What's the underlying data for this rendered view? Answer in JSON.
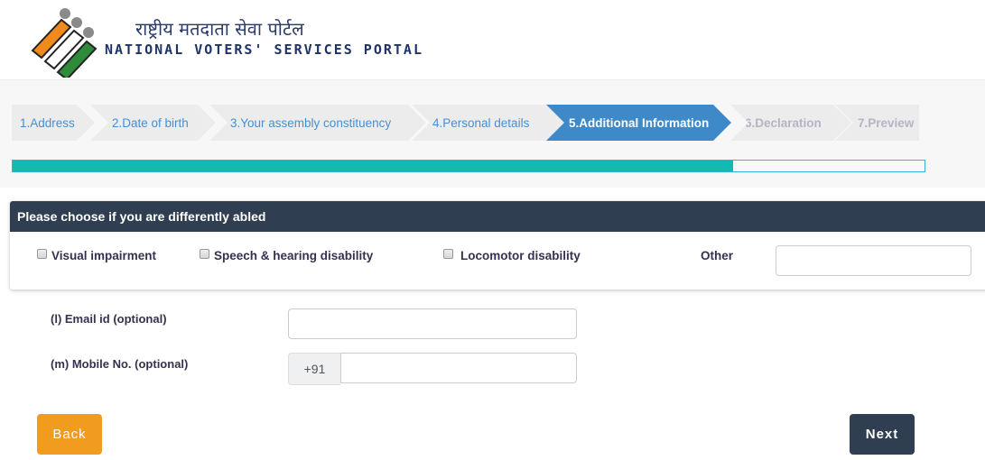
{
  "header": {
    "title_hindi": "राष्ट्रीय मतदाता सेवा पोर्टल",
    "title_english": "NATIONAL VOTERS' SERVICES PORTAL",
    "logo_colors": {
      "saffron": "#f08a1c",
      "green": "#2e8b3a",
      "gray": "#8a8a8a"
    }
  },
  "steps": [
    {
      "label": "1.Address",
      "state": "done"
    },
    {
      "label": "2.Date of birth",
      "state": "done"
    },
    {
      "label": "3.Your assembly constituency",
      "state": "done"
    },
    {
      "label": "4.Personal details",
      "state": "done"
    },
    {
      "label": "5.Additional Information",
      "state": "active"
    },
    {
      "label": "6.Declaration",
      "state": "disabled"
    },
    {
      "label": "7.Preview",
      "state": "disabled"
    }
  ],
  "progress": {
    "percent": 79,
    "color": "#13b9b1"
  },
  "disability_panel": {
    "title": "Please choose if you are differently abled",
    "options": [
      {
        "label": "Visual impairment",
        "checked": false
      },
      {
        "label": "Speech & hearing disability",
        "checked": false
      },
      {
        "label": "Locomotor disability",
        "checked": false
      }
    ],
    "other_label": "Other",
    "other_value": ""
  },
  "form": {
    "email_label": "(l) Email id (optional)",
    "email_value": "",
    "mobile_label": "(m) Mobile No. (optional)",
    "mobile_prefix": "+91",
    "mobile_value": ""
  },
  "buttons": {
    "back": "Back",
    "next": "Next",
    "back_color": "#f29c1f",
    "next_color": "#2f3e50"
  }
}
